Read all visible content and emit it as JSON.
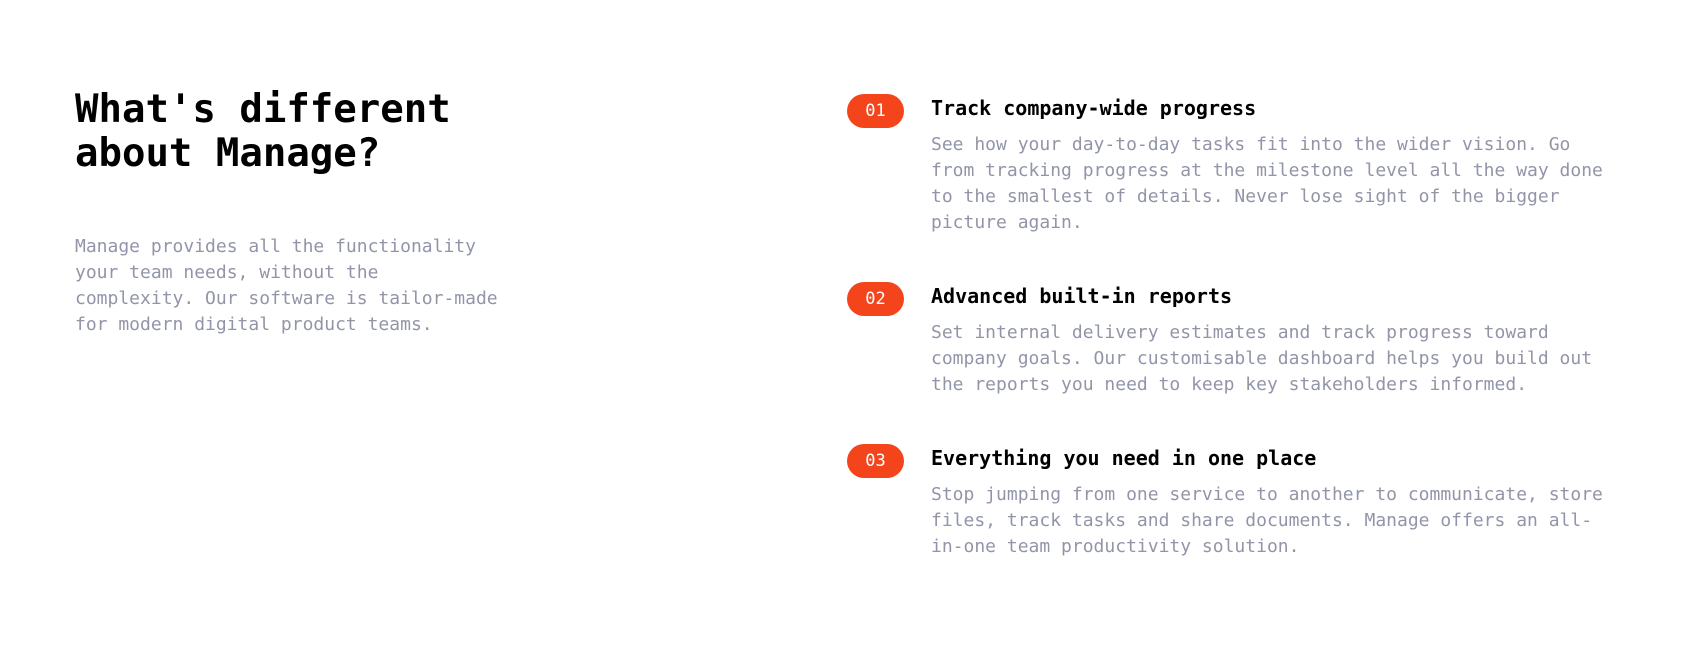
{
  "intro_section": {
    "title_line1": "What's different",
    "title_line2": "about Manage?",
    "description": "Manage provides all the functionality your team needs, without the complexity. Our software is tailor-made for modern digital product teams."
  },
  "features": [
    {
      "number": "01",
      "title": "Track company-wide progress",
      "description": "See how your day-to-day tasks fit into the wider vision. Go from tracking progress at the milestone level all the way done to the smallest of details. Never lose sight of the bigger picture again."
    },
    {
      "number": "02",
      "title": "Advanced built-in reports",
      "description": "Set internal delivery estimates and track progress toward company goals. Our customisable dashboard helps you build out the reports you need to keep key stakeholders informed."
    },
    {
      "number": "03",
      "title": "Everything you need in one place",
      "description": "Stop jumping from one service to another to communicate, store files, track tasks and share documents. Manage offers an all-in-one team productivity solution."
    }
  ],
  "colors": {
    "accent": "#f4441c",
    "heading": "#000000",
    "body_text": "#9295a8"
  }
}
